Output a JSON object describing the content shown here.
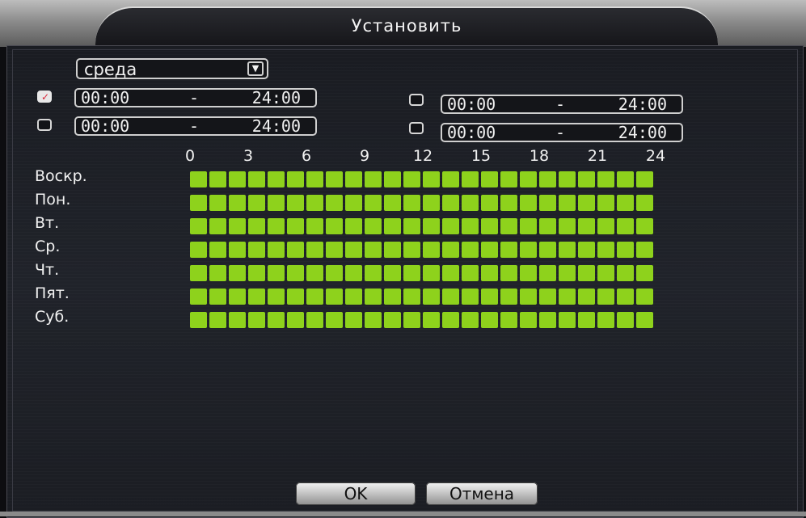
{
  "dialog": {
    "title": "Установить"
  },
  "day_select": {
    "value": "среда"
  },
  "periods": [
    {
      "checked": true,
      "start": "00:00",
      "end": "24:00"
    },
    {
      "checked": false,
      "start": "00:00",
      "end": "24:00"
    },
    {
      "checked": false,
      "start": "00:00",
      "end": "24:00"
    },
    {
      "checked": false,
      "start": "00:00",
      "end": "24:00"
    }
  ],
  "separator": "-",
  "hour_ticks": [
    "0",
    "3",
    "6",
    "9",
    "12",
    "15",
    "18",
    "21",
    "24"
  ],
  "days": [
    "Воскр.",
    "Пон.",
    "Вт.",
    "Ср.",
    "Чт.",
    "Пят.",
    "Суб."
  ],
  "schedule": {
    "slots_per_day": 24,
    "all_enabled": true
  },
  "colors": {
    "slot_on": "#8ed21c",
    "check_mark": "#d9263a"
  },
  "buttons": {
    "ok": "OK",
    "cancel": "Отмена"
  }
}
